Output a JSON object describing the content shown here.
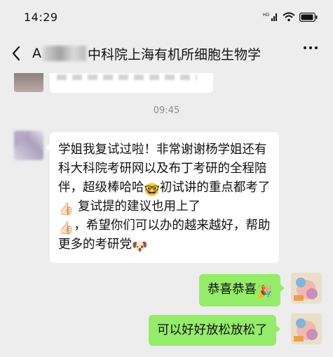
{
  "status_bar": {
    "time": "14:29",
    "network_label": "HD"
  },
  "header": {
    "title_prefix": "A",
    "title_suffix": "中科院上海有机所细胞生物学"
  },
  "chat": {
    "timestamp": "09:45",
    "incoming": {
      "part1": "学姐我复试过啦！非常谢谢杨学姐还有科大科院考研网以及布丁考研的全程陪伴，超级棒哈哈",
      "emoji_nerd": "🤓",
      "part2": "初试讲的重点都考了",
      "emoji_thumb1": "👍🏻",
      "part3": " 复试提的建议也用上了",
      "emoji_thumb2": "👍🏻",
      "part4": "，希望你们可以办的越来越好，帮助更多的考研党",
      "emoji_doge": "🐶"
    },
    "outgoing": [
      {
        "text": "恭喜恭喜",
        "emoji": "🎉"
      },
      {
        "text": "可以好好放松放松了",
        "emoji": ""
      }
    ]
  },
  "colors": {
    "background": "#ededed",
    "outgoing_bubble": "#95ec69",
    "incoming_bubble": "#ffffff"
  },
  "icons": [
    "back-arrow-icon",
    "more-icon",
    "signal-icon",
    "wifi-icon",
    "battery-icon"
  ]
}
